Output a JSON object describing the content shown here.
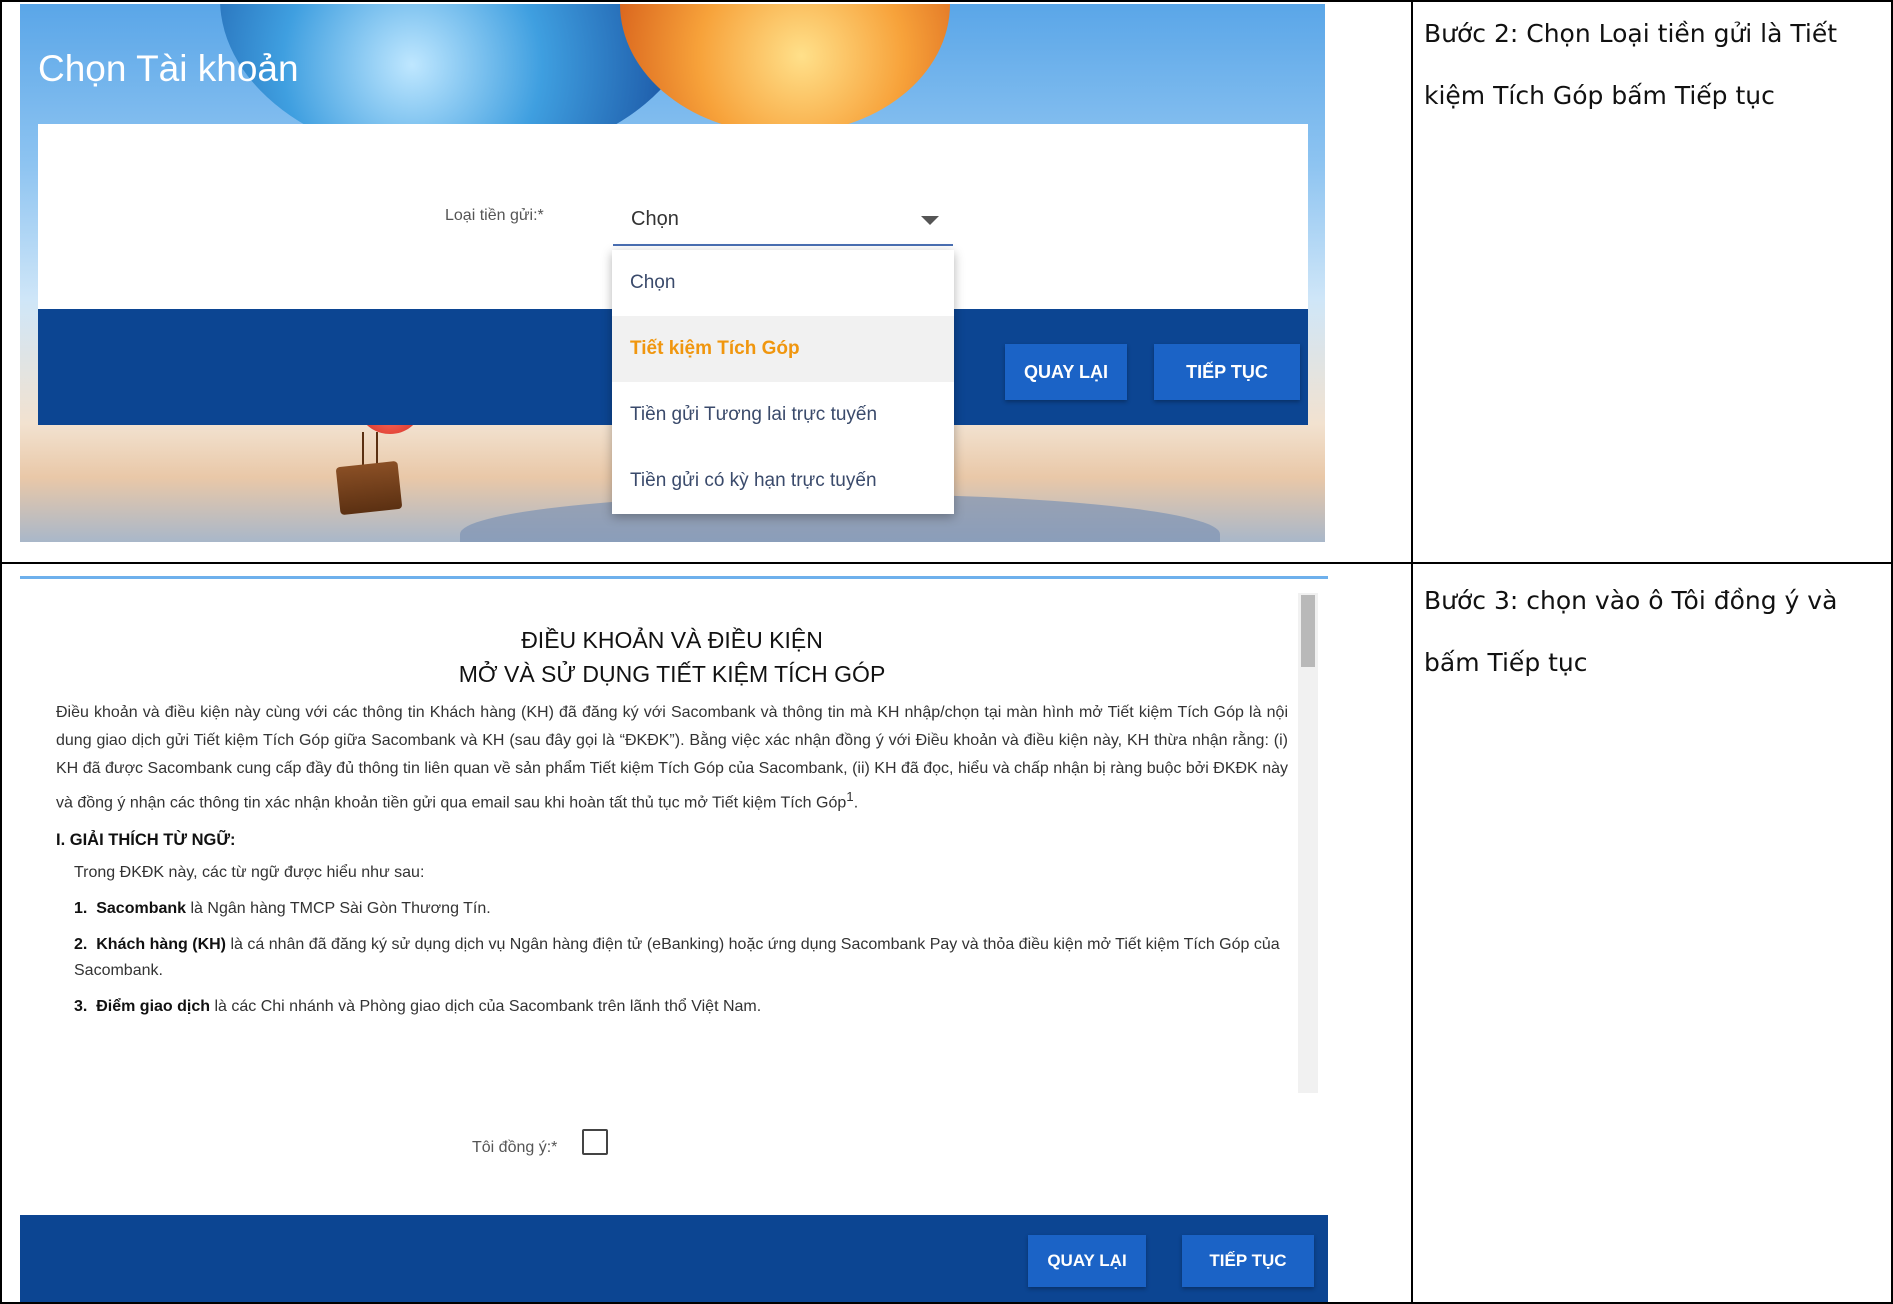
{
  "steps": [
    {
      "caption": "Bước 2: Chọn Loại tiền gửi là Tiết kiệm Tích Góp  bấm Tiếp tục",
      "screen": {
        "title": "Chọn Tài khoản",
        "field_label": "Loại tiền gửi:*",
        "select_value": "Chọn",
        "options": [
          {
            "label": "Chọn"
          },
          {
            "label": "Tiết kiệm Tích Góp"
          },
          {
            "label": "Tiền gửi Tương lai trực tuyến"
          },
          {
            "label": "Tiền gửi có kỳ hạn trực tuyến"
          }
        ],
        "back_label": "QUAY LẠI",
        "next_label": "TIẾP TỤC"
      }
    },
    {
      "caption": "Bước 3: chọn vào ô Tôi đồng ý và bấm Tiếp tục",
      "screen": {
        "heading_line1": "ĐIỀU KHOẢN VÀ ĐIỀU KIỆN",
        "heading_line2": "MỞ VÀ SỬ DỤNG TIẾT KIỆM TÍCH GÓP",
        "intro": "Điều khoản và điều kiện này cùng với các thông tin Khách hàng (KH) đã đăng ký với Sacombank và thông tin mà KH nhập/chọn tại màn hình mở Tiết kiệm Tích Góp là nội dung giao dịch gửi Tiết kiệm Tích Góp giữa Sacombank và KH (sau đây gọi là “ĐKĐK”). Bằng việc xác nhận đồng ý với Điều khoản và điều kiện này, KH thừa nhận rằng: (i) KH đã được Sacombank cung cấp đầy đủ thông tin liên quan về sản phẩm Tiết kiệm Tích Góp của Sacombank, (ii) KH đã đọc, hiểu và chấp nhận bị ràng buộc bởi ĐKĐK này và đồng ý nhận các thông tin xác nhận khoản tiền gửi qua email sau khi hoàn tất thủ tục mở Tiết kiệm Tích Góp",
        "footnote_mark": "1",
        "section_title": "I. GIẢI THÍCH TỪ NGỮ:",
        "section_intro": "Trong ĐKĐK này, các từ ngữ được hiểu như sau:",
        "items": [
          {
            "num": "1.",
            "term": "Sacombank",
            "text": " là Ngân hàng TMCP Sài Gòn Thương Tín."
          },
          {
            "num": "2.",
            "term": "Khách hàng (KH)",
            "text": " là cá nhân đã đăng ký sử dụng dịch vụ Ngân hàng điện tử (eBanking) hoặc ứng dụng Sacombank Pay và thỏa điều kiện mở Tiết kiệm Tích Góp của Sacombank."
          },
          {
            "num": "3.",
            "term": "Điểm giao dịch",
            "text": " là các Chi nhánh và Phòng giao dịch của Sacombank trên lãnh thổ Việt Nam."
          }
        ],
        "agree_label": "Tôi đồng ý:*",
        "back_label": "QUAY LẠI",
        "next_label": "TIẾP TỤC"
      }
    }
  ]
}
